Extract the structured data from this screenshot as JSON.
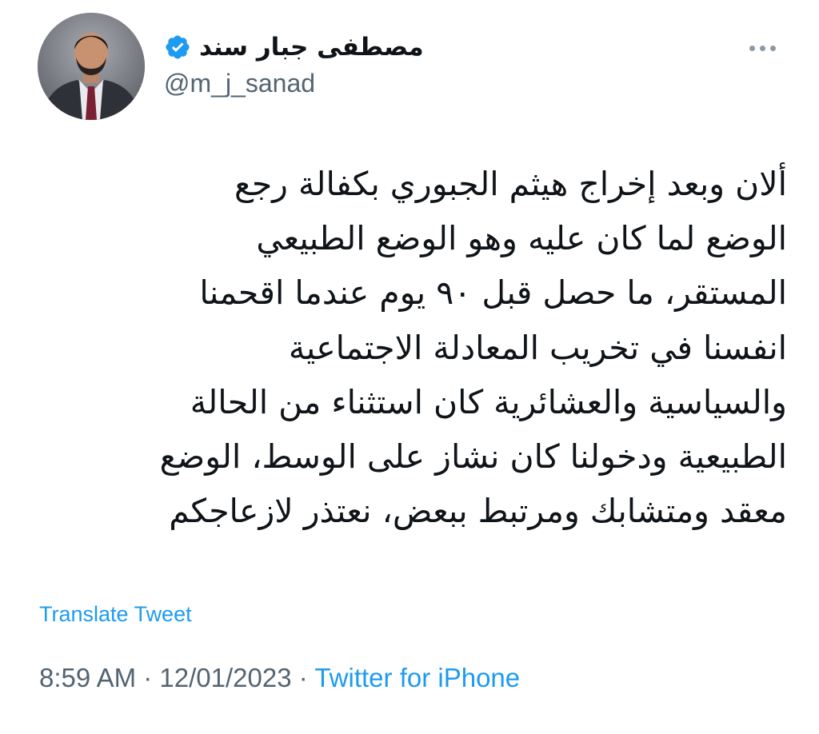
{
  "author": {
    "display_name": "مصطفى جبار سند",
    "handle": "@m_j_sanad"
  },
  "tweet": {
    "lines": [
      "ألان وبعد إخراج هيثم الجبوري بكفالة رجع",
      "الوضع لما كان عليه وهو الوضع الطبيعي",
      "المستقر، ما حصل قبل ٩٠ يوم عندما اقحمنا",
      "انفسنا في تخريب المعادلة الاجتماعية",
      "والسياسية والعشائرية كان استثناء من الحالة",
      "الطبيعية ودخولنا كان نشاز على الوسط، الوضع",
      "معقد ومتشابك ومرتبط ببعض، نعتذر لازعاجكم"
    ],
    "translate_label": "Translate Tweet",
    "time": "8:59 AM",
    "separator": "·",
    "date": "12/01/2023",
    "source": "Twitter for iPhone"
  },
  "icons": {
    "verified": "verified-badge-icon",
    "more": "more-options-icon"
  },
  "colors": {
    "accent": "#1d9bf0",
    "text": "#0f1419",
    "secondary": "#536471"
  }
}
